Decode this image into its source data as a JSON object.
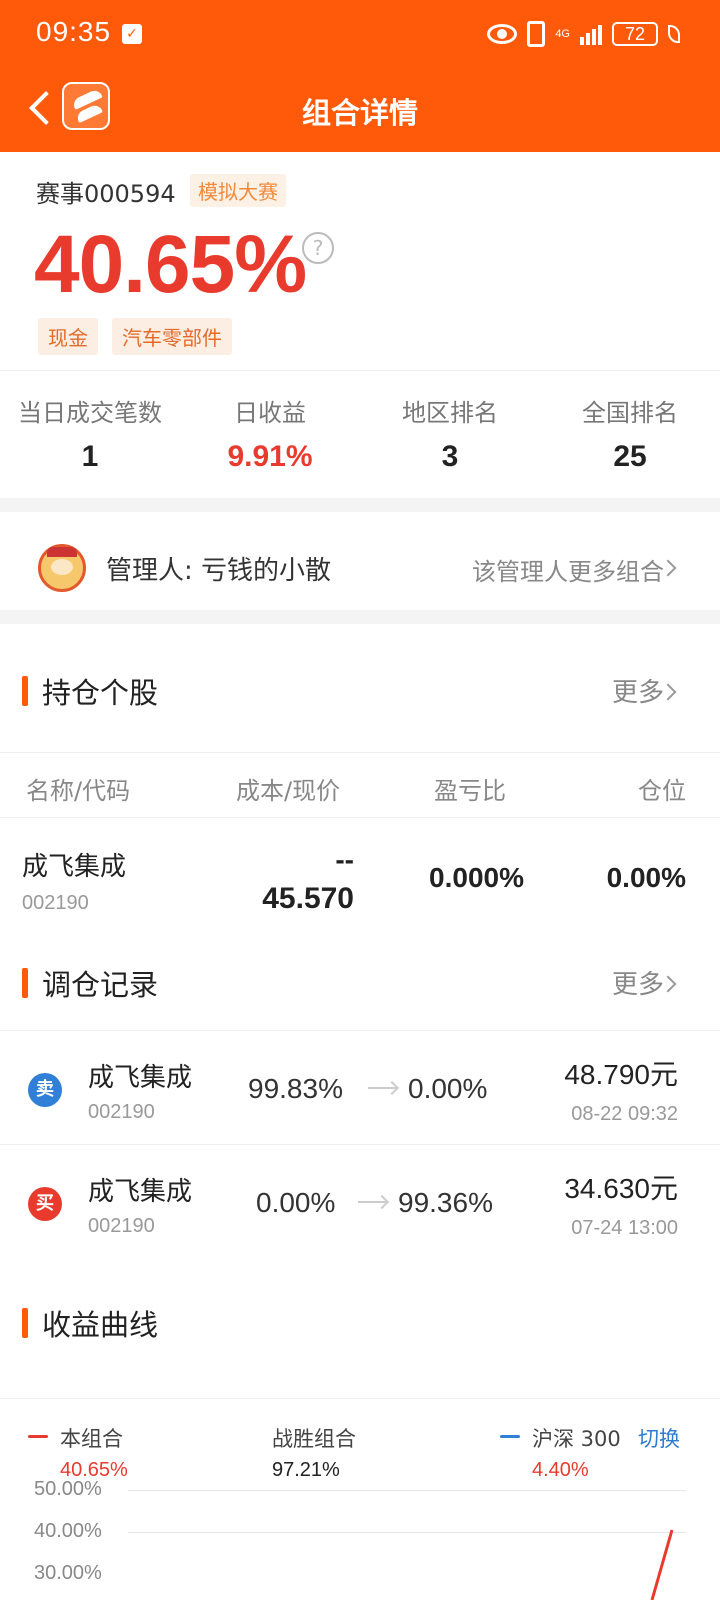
{
  "status_bar": {
    "time": "09:35",
    "network": "4G",
    "battery": "72",
    "icons": [
      "app-notification-icon",
      "eye-icon",
      "vibrate-icon",
      "signal-icon",
      "battery-icon",
      "leaf-icon"
    ]
  },
  "nav": {
    "title": "组合详情",
    "icons": [
      "back-icon",
      "app-logo-icon"
    ]
  },
  "summary": {
    "contest_id": "赛事000594",
    "contest_badge": "模拟大赛",
    "total_return": "40.65%",
    "tags": [
      "现金",
      "汽车零部件"
    ],
    "colors": {
      "accent": "#ff5a0a",
      "gain": "#e83b2e"
    }
  },
  "stats": [
    {
      "label": "当日成交笔数",
      "value": "1"
    },
    {
      "label": "日收益",
      "value": "9.91%"
    },
    {
      "label": "地区排名",
      "value": "3"
    },
    {
      "label": "全国排名",
      "value": "25"
    }
  ],
  "manager": {
    "label": "管理人:  亏钱的小散",
    "more": "该管理人更多组合"
  },
  "holdings": {
    "title": "持仓个股",
    "more": "更多",
    "headers": [
      "名称/代码",
      "成本/现价",
      "盈亏比",
      "仓位"
    ],
    "rows": [
      {
        "name": "成飞集成",
        "code": "002190",
        "cost": "--",
        "price": "45.570",
        "pl_ratio": "0.000%",
        "position": "0.00%"
      }
    ]
  },
  "trades": {
    "title": "调仓记录",
    "more": "更多",
    "rows": [
      {
        "type": "卖",
        "name": "成飞集成",
        "code": "002190",
        "from": "99.83%",
        "to": "0.00%",
        "price": "48.790元",
        "time": "08-22 09:32",
        "badge_color": "#2f80d6"
      },
      {
        "type": "买",
        "name": "成飞集成",
        "code": "002190",
        "from": "0.00%",
        "to": "99.36%",
        "price": "34.630元",
        "time": "07-24 13:00",
        "badge_color": "#e83b2e"
      }
    ]
  },
  "returns_chart": {
    "title": "收益曲线",
    "legend": [
      {
        "name": "本组合",
        "value": "40.65%",
        "color": "#e83b2e"
      },
      {
        "name": "战胜组合",
        "value": "97.21%",
        "color": "#222222"
      },
      {
        "name": "沪深 300",
        "value": "4.40%",
        "color": "#2f80d6"
      }
    ],
    "switch_label": "切换",
    "y_ticks": [
      "50.00%",
      "40.00%",
      "30.00%"
    ]
  }
}
